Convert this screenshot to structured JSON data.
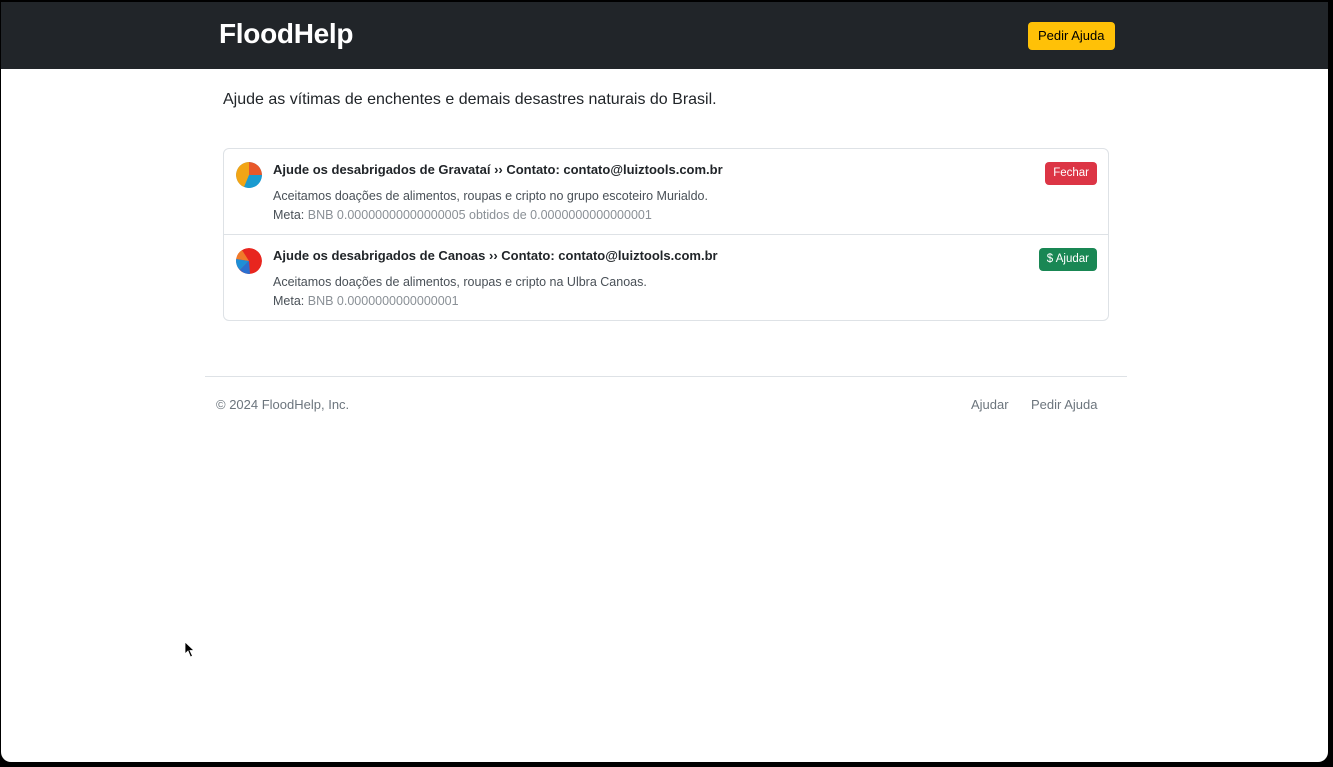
{
  "navbar": {
    "brand": "FloodHelp",
    "request_help_label": "Pedir Ajuda"
  },
  "main": {
    "lead": "Ajude as vítimas de enchentes e demais desastres naturais do Brasil.",
    "requests": [
      {
        "title": "Ajude os desabrigados de Gravataí ›› Contato: contato@luiztools.com.br",
        "description": "Aceitamos doações de alimentos, roupas e cripto no grupo escoteiro Murialdo.",
        "meta_label": "Meta:",
        "meta_value": "BNB 0.00000000000000005 obtidos de 0.0000000000000001",
        "action_label": "Fechar",
        "action_color": "#dc3545"
      },
      {
        "title": "Ajude os desabrigados de Canoas ›› Contato: contato@luiztools.com.br",
        "description": "Aceitamos doações de alimentos, roupas e cripto na Ulbra Canoas.",
        "meta_label": "Meta:",
        "meta_value": "BNB 0.0000000000000001",
        "action_label": "$ Ajudar",
        "action_color": "#198754"
      }
    ]
  },
  "footer": {
    "copyright": "© 2024 FloodHelp, Inc.",
    "links": [
      "Ajudar",
      "Pedir Ajuda"
    ]
  },
  "colors": {
    "navbar_bg": "#212529",
    "warning": "#ffc107",
    "danger": "#dc3545",
    "success": "#198754"
  }
}
